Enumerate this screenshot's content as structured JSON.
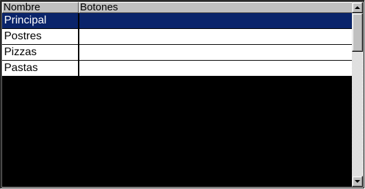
{
  "grid": {
    "columns": [
      {
        "label": "Nombre"
      },
      {
        "label": "Botones"
      }
    ],
    "rows": [
      {
        "nombre": "Principal",
        "botones": "",
        "selected": true
      },
      {
        "nombre": "Postres",
        "botones": "",
        "selected": false
      },
      {
        "nombre": "Pizzas",
        "botones": "",
        "selected": false
      },
      {
        "nombre": "Pastas",
        "botones": "",
        "selected": false
      }
    ],
    "selection_color": "#0a246a",
    "empty_area_color": "#000000"
  },
  "scrollbar": {
    "up_icon": "arrow-up-icon",
    "down_icon": "arrow-down-icon"
  }
}
